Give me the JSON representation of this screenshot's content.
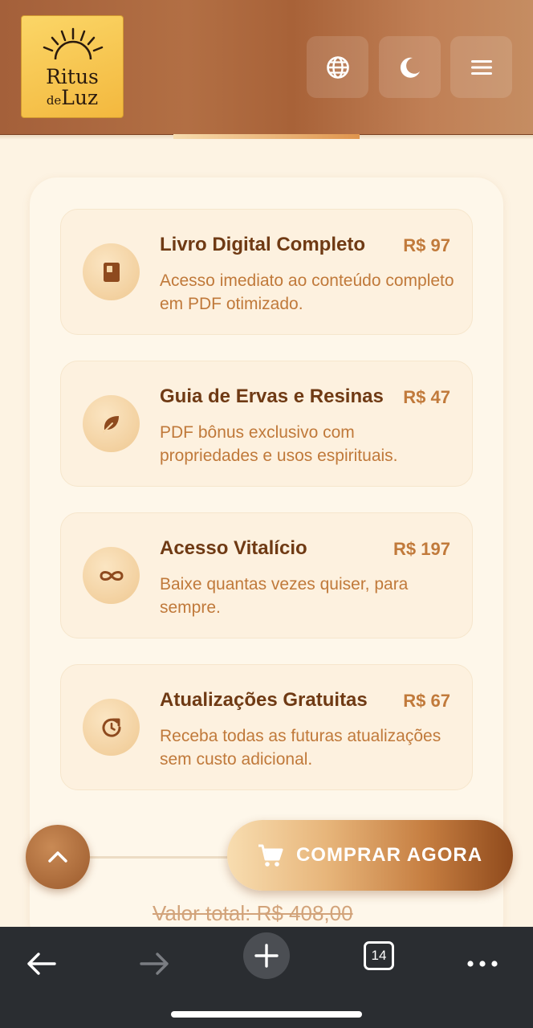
{
  "header": {
    "logo": {
      "line1": "Ritus",
      "line2_small": "de",
      "line2_large": "Luz"
    },
    "buttons": [
      {
        "name": "language",
        "icon": "globe-icon"
      },
      {
        "name": "theme",
        "icon": "moon-icon"
      },
      {
        "name": "menu",
        "icon": "menu-icon"
      }
    ]
  },
  "items": [
    {
      "title": "Livro Digital Completo",
      "price": "R$ 97",
      "description": "Acesso imediato ao conteúdo completo em PDF otimizado.",
      "icon": "book-icon"
    },
    {
      "title": "Guia de Ervas e Resinas",
      "price": "R$ 47",
      "description": "PDF bônus exclusivo com propriedades e usos espirituais.",
      "icon": "leaf-icon"
    },
    {
      "title": "Acesso Vitalício",
      "price": "R$ 197",
      "description": "Baixe quantas vezes quiser, para sempre.",
      "icon": "infinity-icon"
    },
    {
      "title": "Atualizações Gratuitas",
      "price": "R$ 67",
      "description": "Receba todas as futuras atualizações sem custo adicional.",
      "icon": "refresh-icon"
    }
  ],
  "cta": {
    "label": "COMPRAR AGORA",
    "icon": "cart-icon"
  },
  "total": {
    "text": "Valor total: R$ 408,00"
  },
  "browser": {
    "tab_count": "14"
  },
  "colors": {
    "brand_brown": "#a4603a",
    "accent_gold": "#f3b83e",
    "text_dark": "#6f3a14",
    "text_light": "#c0793a"
  }
}
